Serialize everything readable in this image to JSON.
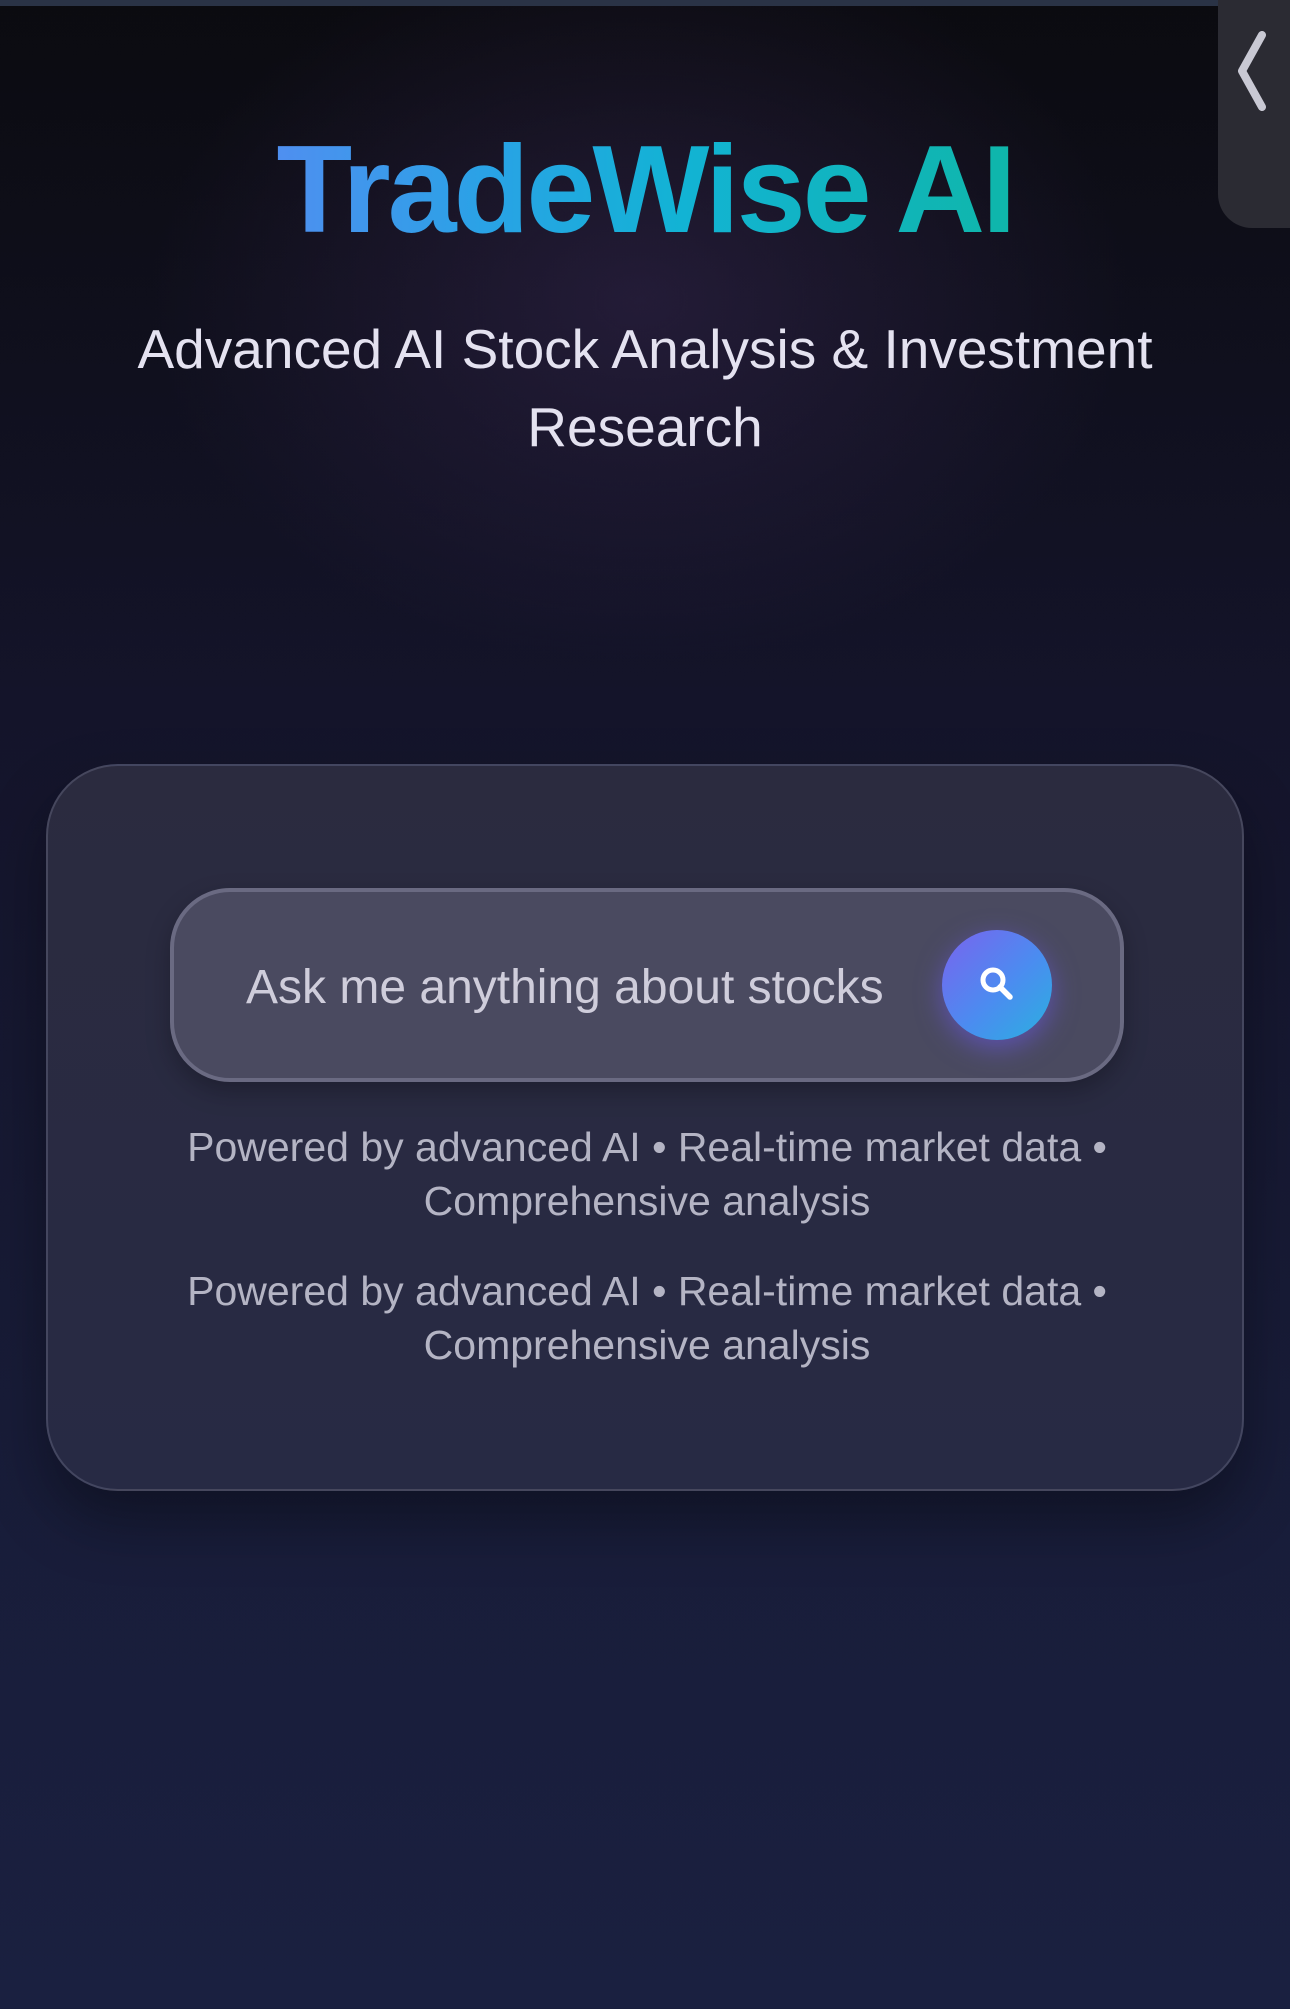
{
  "header": {
    "brand_name": "TradeWise AI",
    "subtitle": "Advanced AI Stock Analysis & Investment Research"
  },
  "side_tab": {
    "icon": "chevron-left-icon"
  },
  "search": {
    "placeholder": "Ask me anything about stocks",
    "button_icon": "search-icon"
  },
  "taglines": [
    "Powered by advanced AI • Real-time market data • Comprehensive analysis",
    "Powered by advanced AI • Real-time market data • Comprehensive analysis"
  ],
  "colors": {
    "brand_gradient_start": "#4f8ff0",
    "brand_gradient_end": "#0fb6aa",
    "button_gradient_start": "#7a63ee",
    "button_gradient_end": "#2ab0e0",
    "background": "#14142a"
  }
}
